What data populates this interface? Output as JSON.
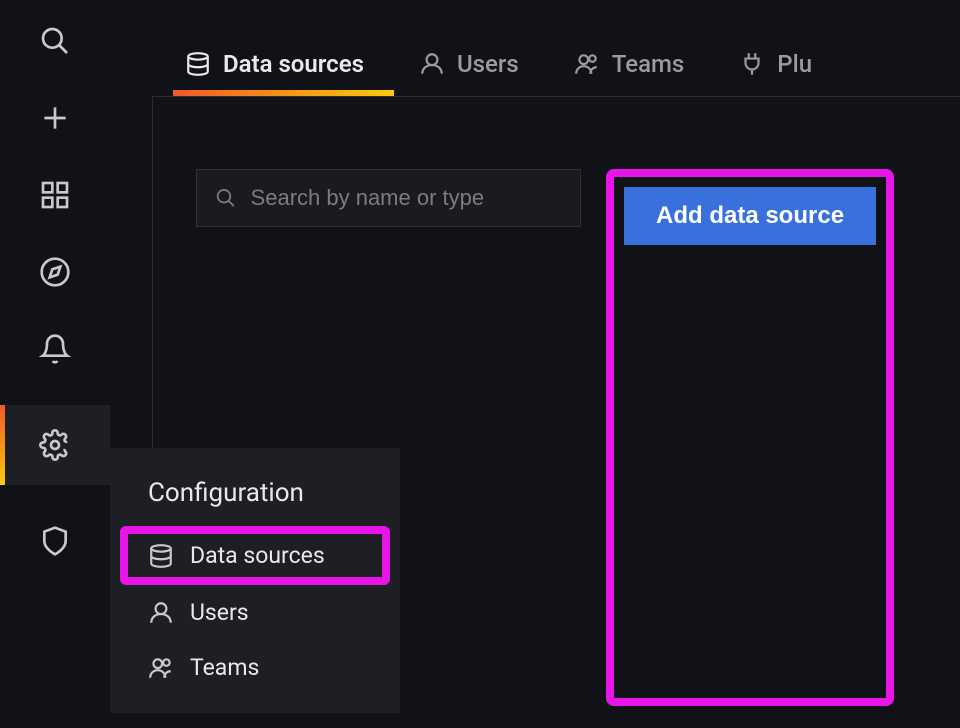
{
  "sidebar": {
    "items": [
      {
        "name": "search",
        "icon": "search-icon"
      },
      {
        "name": "create",
        "icon": "plus-icon"
      },
      {
        "name": "dashboards",
        "icon": "grid-icon"
      },
      {
        "name": "explore",
        "icon": "compass-icon"
      },
      {
        "name": "alerting",
        "icon": "bell-icon"
      },
      {
        "name": "configuration",
        "icon": "gear-icon",
        "active": true
      },
      {
        "name": "admin",
        "icon": "shield-icon"
      }
    ]
  },
  "tabs": {
    "items": [
      {
        "label": "Data sources",
        "icon": "database-icon",
        "active": true
      },
      {
        "label": "Users",
        "icon": "user-icon"
      },
      {
        "label": "Teams",
        "icon": "team-icon"
      },
      {
        "label": "Plu",
        "icon": "plug-icon"
      }
    ]
  },
  "search": {
    "placeholder": "Search by name or type"
  },
  "buttons": {
    "add_data_source": "Add data source"
  },
  "flyout": {
    "title": "Configuration",
    "items": [
      {
        "label": "Data sources",
        "icon": "database-icon",
        "highlighted": true
      },
      {
        "label": "Users",
        "icon": "user-icon"
      },
      {
        "label": "Teams",
        "icon": "team-icon"
      }
    ]
  },
  "highlights": {
    "color": "#e815e8"
  }
}
